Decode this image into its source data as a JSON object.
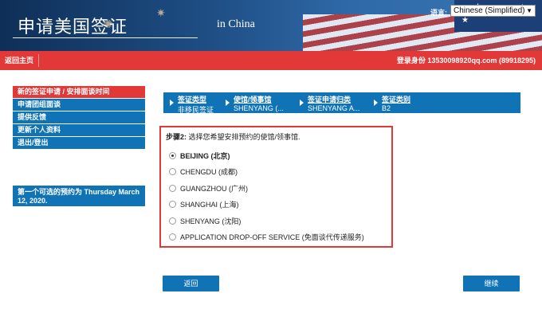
{
  "header": {
    "title": "申请美国签证",
    "subtitle": "in China",
    "language_label": "语言:",
    "language_value": "Chinese (Simplified)",
    "language_arrow": "▼"
  },
  "navbar": {
    "home_label": "返回主页",
    "login_text": "登录身份 13530098920qq.com (89918295)"
  },
  "menu": {
    "items": [
      {
        "label": "新的签证申请 / 安排面谈时间"
      },
      {
        "label": "申请团组面谈"
      },
      {
        "label": "提供反馈"
      },
      {
        "label": "更新个人资料"
      },
      {
        "label": "退出/登出"
      }
    ],
    "notice": "第一个可选的预约为 Thursday March 12, 2020."
  },
  "steps": [
    {
      "label": "签证类型",
      "value": "非移民签证"
    },
    {
      "label": "使馆/领事馆",
      "value": "SHENYANG (..."
    },
    {
      "label": "签证申请归类",
      "value": "SHENYANG A..."
    },
    {
      "label": "签证类别",
      "value": "B2"
    }
  ],
  "selection": {
    "prompt_step": "步骤2:",
    "prompt_text": " 选择您希望安排预约的使馆/领事馆.",
    "options": [
      {
        "label": "BEIJING (北京)",
        "checked": true
      },
      {
        "label": "CHENGDU (成都)",
        "checked": false
      },
      {
        "label": "GUANGZHOU (广州)",
        "checked": false
      },
      {
        "label": "SHANGHAI (上海)",
        "checked": false
      },
      {
        "label": "SHENYANG (沈阳)",
        "checked": false
      },
      {
        "label": "APPLICATION DROP-OFF SERVICE (免面谈代传递服务)",
        "checked": false
      }
    ]
  },
  "buttons": {
    "back": "返回",
    "next": "继续"
  },
  "colors": {
    "accent_blue": "#0f73b6",
    "accent_red": "#e23838"
  }
}
